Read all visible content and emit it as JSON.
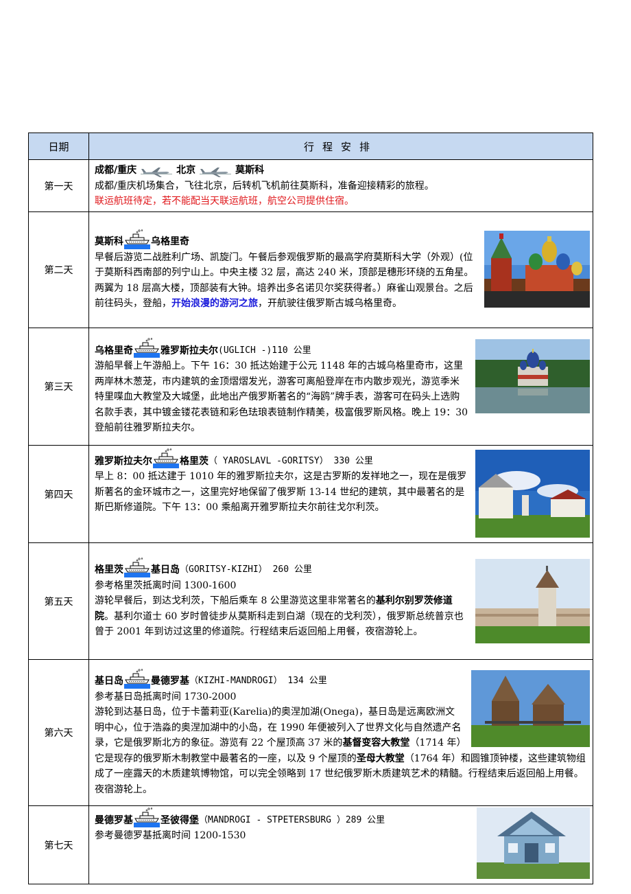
{
  "header": {
    "date": "日期",
    "plan": "行程安排"
  },
  "days": [
    {
      "label": "第一天",
      "route_a": "成都/重庆",
      "route_b": "北京",
      "route_c": "莫斯科",
      "body": "成都/重庆机场集合，飞往北京，后转机飞机前往莫斯科，准备迎接精彩的旅程。",
      "note": "联运航班待定，若不能配当天联运航班，航空公司提供住宿。"
    },
    {
      "label": "第二天",
      "route_a": "莫斯科",
      "route_b": "乌格里奇",
      "body_1": "早餐后游览二战胜利广场、凯旋门。午餐后参观俄罗斯的最高学府莫斯科大学（外观）(位于莫斯科西南部的列宁山上。中央主楼 32 层，高达 240 米，顶部是穗形环绕的五角星。两翼为 18 层高大楼，顶部装有大钟。培养出多名诺贝尔奖获得者。）麻雀山观景台。之后前往码头，登船，",
      "highlight": "开始浪漫的游河之旅",
      "body_2": "，开航驶往俄罗斯古城乌格里奇。"
    },
    {
      "label": "第三天",
      "route_a": "乌格里奇",
      "route_b": "雅罗斯拉夫尔",
      "route_extra": "(UGLICH -)110 公里",
      "body": "游船早餐上午游船上。下午 16：30 抵达始建于公元 1148 年的古城乌格里奇市，这里两岸林木葱茏，市内建筑的金顶熠熠发光，游客可离船登岸在市内散步观光，游览季米特里喋血大教堂及大城堡，此地出产俄罗斯著名的“海鸥”牌手表，游客可在码头上选购名款手表，其中镀金镂花表链和彩色珐琅表链制作精美，极富俄罗斯风格。晚上 19：30 登船前往雅罗斯拉夫尔。"
    },
    {
      "label": "第四天",
      "route_a": "雅罗斯拉夫尔",
      "route_b": "格里茨",
      "route_extra": "（ YAROSLAVL -GORITSY）  330 公里",
      "body": "早上 8：00 抵达建于 1010 年的雅罗斯拉夫尔，这是古罗斯的发祥地之一，现在是俄罗斯著名的金环城市之一，这里完好地保留了俄罗斯 13-14 世纪的建筑，其中最著名的是斯巴斯修道院。下午 13：00 乘船离开雅罗斯拉夫尔前往戈尔利茨。"
    },
    {
      "label": "第五天",
      "route_a": "格里茨",
      "route_b": "基日岛",
      "route_extra": "（GORITSY-KIZHI） 260 公里",
      "ref": "参考格里茨抵离时间 1300-1600",
      "body_1": "游轮早餐后，到达戈利茨，下船后乘车 8 公里游览这里非常著名的",
      "bold_1": "基利尔别罗茨修道院",
      "body_2": "。基利尔道士 60 岁时曾徒步从莫斯科走到白湖（现在的戈利茨），俄罗斯总统普京也曾于 2001 年到访过这里的修道院。行程结束后返回船上用餐，夜宿游轮上。"
    },
    {
      "label": "第六天",
      "route_a": "基日岛",
      "route_b": "曼德罗基",
      "route_extra": " （KIZHI-MANDROGI） 134 公里",
      "ref": "参考基日岛抵离时间 1730-2000",
      "body_1": "游轮到达基日岛，位于卡蕾莉亚(Karelia)的奥涅加湖(Onega)，基日岛是远离欧洲文明中心，位于浩淼的奥涅加湖中的小岛，在 1990 年便被列入了世界文化与自然遗产名录，它是俄罗斯北方的象征。游览有 22 个屋顶高 37 米的",
      "bold_1": "基督变容大教堂",
      "body_2": "（1714 年）它是现存的俄罗斯木制教堂中最著名的一座，以及 9 个屋顶的",
      "bold_2": "圣母大教堂",
      "body_3": "（1764 年）和圆锥顶钟楼，这些建筑物组成了一座露天的木质建筑博物馆，可以完全领略到 17 世纪俄罗斯木质建筑艺术的精髓。行程结束后返回船上用餐。夜宿游轮上。"
    },
    {
      "label": "第七天",
      "route_a": "曼德罗基",
      "route_b": "圣彼得堡",
      "route_extra": "（MANDROGI - STPETERSBURG ）289 公里",
      "ref": "参考曼德罗基抵离时间 1200-1530"
    }
  ],
  "icons": {
    "plane": "airplane-icon",
    "ship": "ship-icon"
  }
}
